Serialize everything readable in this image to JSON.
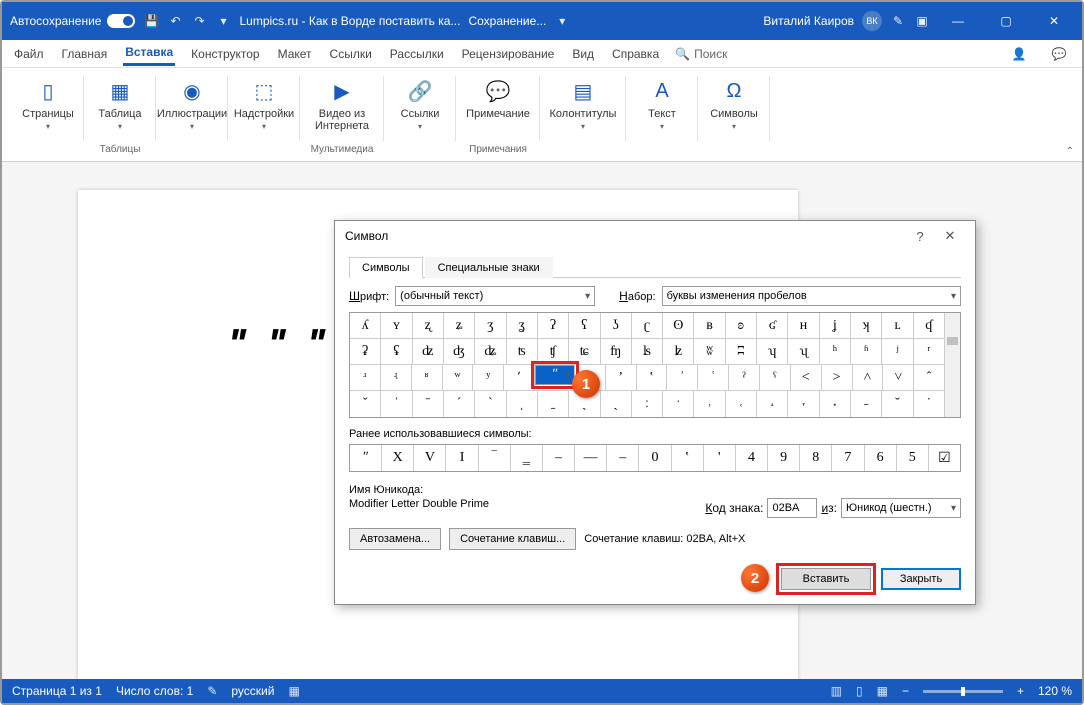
{
  "titlebar": {
    "autosave": "Автосохранение",
    "title": "Lumpics.ru - Как в Ворде поставить ка...",
    "saving": "Сохранение...",
    "user": "Виталий Каиров",
    "initials": "ВК"
  },
  "tabs": {
    "file": "Файл",
    "home": "Главная",
    "insert": "Вставка",
    "design": "Конструктор",
    "layout": "Макет",
    "references": "Ссылки",
    "mailings": "Рассылки",
    "review": "Рецензирование",
    "view": "Вид",
    "help": "Справка",
    "search": "Поиск"
  },
  "ribbon": {
    "pages": {
      "label": "Страницы"
    },
    "tables": {
      "label": "Таблицы",
      "btn": "Таблица"
    },
    "illustrations": {
      "label": "Иллюстрации",
      "btn": "Иллюстрации"
    },
    "addins": {
      "label": "Надстройки",
      "btn": "Надстройки"
    },
    "media": {
      "label": "Мультимедиа",
      "btn": "Видео из Интернета"
    },
    "links": {
      "btn": "Ссылки"
    },
    "comments": {
      "label": "Примечания",
      "btn": "Примечание"
    },
    "headerfooter": {
      "btn": "Колонтитулы"
    },
    "text": {
      "btn": "Текст"
    },
    "symbols": {
      "btn": "Символы"
    }
  },
  "page": {
    "text": "ʺ ʺ ʺ ʺ"
  },
  "dialog": {
    "title": "Символ",
    "help": "?",
    "close": "✕",
    "tab1": "Символы",
    "tab2": "Специальные знаки",
    "font_lbl": "Шрифт:",
    "font_val": "(обычный текст)",
    "set_lbl": "Набор:",
    "set_val": "буквы изменения пробелов",
    "grid": [
      [
        "ʎ",
        "ʏ",
        "ʐ",
        "ʑ",
        "ʒ",
        "ʓ",
        "ʔ",
        "ʕ",
        "ʖ",
        "ʗ",
        "ʘ",
        "ʙ",
        "ʚ",
        "ʛ",
        "ʜ",
        "ʝ",
        "ʞ",
        "ʟ",
        "ʠ"
      ],
      [
        "ʡ",
        "ʢ",
        "ʣ",
        "ʤ",
        "ʥ",
        "ʦ",
        "ʧ",
        "ʨ",
        "ʩ",
        "ʪ",
        "ʫ",
        "ʬ",
        "ʭ",
        "ʮ",
        "ʯ",
        "ʰ",
        "ʱ",
        "ʲ",
        "ʳ"
      ],
      [
        "ʴ",
        "ʵ",
        "ʶ",
        "ʷ",
        "ʸ",
        "ʹ",
        "ʺ",
        "ʻ",
        "ʼ",
        "ʽ",
        "ʾ",
        "ʿ",
        "ˀ",
        "ˁ",
        "˂",
        "˃",
        "˄",
        "˅",
        "ˆ"
      ],
      [
        "ˇ",
        "ˈ",
        "ˉ",
        "ˊ",
        "ˋ",
        "ˌ",
        "ˍ",
        "ˎ",
        "ˏ",
        "ː",
        "ˑ",
        "˒",
        "˓",
        "˔",
        "˕",
        "˖",
        "˗",
        "˘",
        "˙"
      ]
    ],
    "recent_lbl": "Ранее использовавшиеся символы:",
    "recent": [
      "ʺ",
      "X",
      "V",
      "I",
      "‾",
      "‗",
      "‒",
      "—",
      "–",
      "0",
      "‛",
      "'",
      "4",
      "9",
      "8",
      "7",
      "6",
      "5",
      "☑"
    ],
    "uni_lbl": "Имя Юникода:",
    "uni_name": "Modifier Letter Double Prime",
    "code_lbl": "Код знака:",
    "code_val": "02BA",
    "from_lbl": "из:",
    "from_val": "Юникод (шестн.)",
    "autocorrect": "Автозамена...",
    "shortcut": "Сочетание клавиш...",
    "shortcut_info": "Сочетание клавиш: 02BA, Alt+X",
    "insert": "Вставить",
    "close_btn": "Закрыть"
  },
  "callouts": {
    "c1": "1",
    "c2": "2"
  },
  "status": {
    "page": "Страница 1 из 1",
    "words": "Число слов: 1",
    "lang": "русский",
    "zoom": "120 %"
  }
}
